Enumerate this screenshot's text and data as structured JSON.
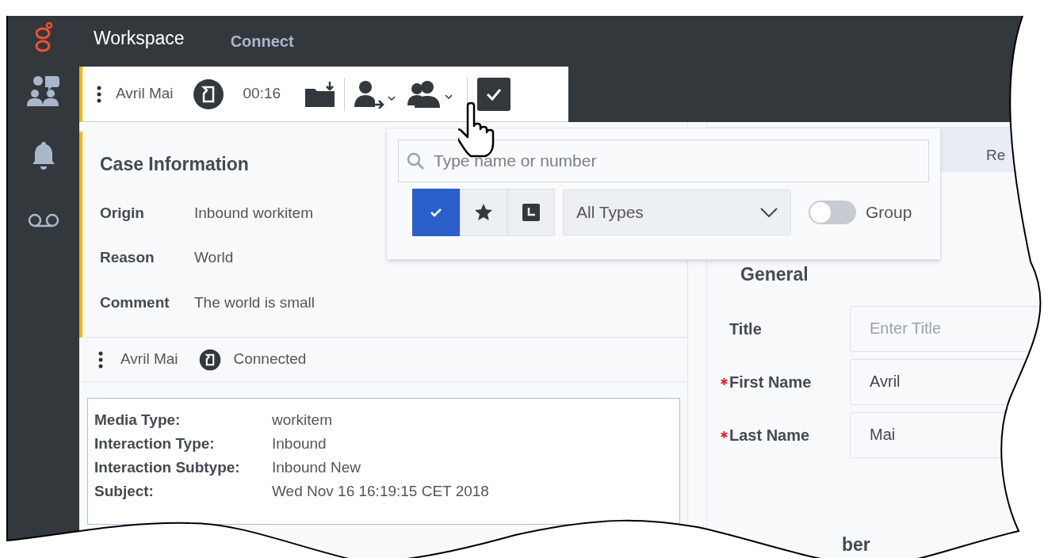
{
  "app": {
    "title": "Workspace"
  },
  "nav_tabs": [
    {
      "label": "Connect",
      "selected": true
    }
  ],
  "sidebar_items": [
    {
      "kind": "team"
    },
    {
      "kind": "notifications"
    },
    {
      "kind": "voicemail"
    }
  ],
  "toolbar": {
    "contact": "Avril Mai",
    "timer": "00:16"
  },
  "case_information": {
    "title": "Case Information",
    "fields": [
      {
        "label": "Origin",
        "value": "Inbound workitem"
      },
      {
        "label": "Reason",
        "value": "World"
      },
      {
        "label": "Comment",
        "value": "The world is small"
      }
    ]
  },
  "interaction": {
    "contact": "Avril Mai",
    "status": "Connected",
    "details": [
      {
        "label": "Media Type:",
        "value": "workitem"
      },
      {
        "label": "Interaction Type:",
        "value": "Inbound"
      },
      {
        "label": "Interaction Subtype:",
        "value": "Inbound New"
      },
      {
        "label": "Subject:",
        "value": "Wed Nov 16 16:19:15 CET 2018"
      }
    ]
  },
  "popover": {
    "search": {
      "placeholder": "Type name or number"
    },
    "filters": [
      {
        "kind": "check",
        "selected": true
      },
      {
        "kind": "star",
        "selected": false
      },
      {
        "kind": "recent",
        "selected": false
      }
    ],
    "type_dropdown": {
      "value": "All Types"
    },
    "group_toggle": {
      "label": "Group",
      "on": false
    }
  },
  "right_panel": {
    "tab_partial": "Re",
    "section": "General",
    "fields": [
      {
        "label": "Title",
        "placeholder": "Enter Title",
        "required": false
      },
      {
        "label": "First Name",
        "value": "Avril",
        "required": true
      },
      {
        "label": "Last Name",
        "value": "Mai",
        "required": true
      }
    ],
    "next_section_partial": "ber"
  }
}
